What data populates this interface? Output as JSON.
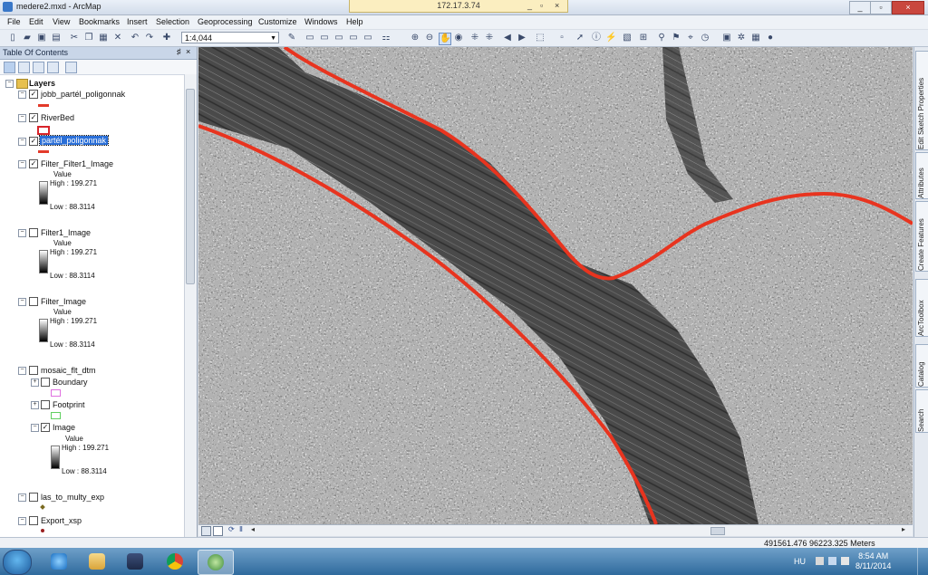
{
  "window": {
    "title": "medere2.mxd - ArcMap",
    "remote_session": "172.17.3.74",
    "controls": [
      "_",
      "▫",
      "×"
    ]
  },
  "menu": [
    "File",
    "Edit",
    "View",
    "Bookmarks",
    "Insert",
    "Selection",
    "Geoprocessing",
    "Customize",
    "Windows",
    "Help"
  ],
  "toolbar": {
    "scale": "1:4,044"
  },
  "toc": {
    "title": "Table Of Contents",
    "root": "Layers",
    "layers": [
      {
        "name": "jobb_partél_poligonnak",
        "checked": true
      },
      {
        "name": "RiverBed",
        "checked": true
      },
      {
        "name": "partél_poligonnak",
        "checked": true,
        "selected": true
      },
      {
        "name": "Filter_Filter1_Image",
        "checked": true,
        "value_label": "Value",
        "high": "High : 199.271",
        "low": "Low : 88.3114"
      },
      {
        "name": "Filter1_Image",
        "checked": false,
        "value_label": "Value",
        "high": "High : 199.271",
        "low": "Low : 88.3114"
      },
      {
        "name": "Filter_Image",
        "checked": false,
        "value_label": "Value",
        "high": "High : 199.271",
        "low": "Low : 88.3114"
      },
      {
        "name": "mosaic_flt_dtm",
        "checked": false,
        "sublayers": [
          {
            "name": "Boundary",
            "checked": false
          },
          {
            "name": "Footprint",
            "checked": false
          },
          {
            "name": "Image",
            "checked": true,
            "value_label": "Value",
            "high": "High : 199.271",
            "low": "Low : 88.3114"
          }
        ]
      },
      {
        "name": "las_to_multy_exp",
        "checked": false
      },
      {
        "name": "Export_xsp",
        "checked": false
      }
    ]
  },
  "dock_tabs": [
    "Edit Sketch Properties",
    "Attributes",
    "Create Features",
    "ArcToolbox",
    "Catalog",
    "Search"
  ],
  "status": {
    "coordinates": "491561.476  96223.325 Meters"
  },
  "taskbar": {
    "language": "HU",
    "time": "8:54 AM",
    "date": "8/11/2014"
  },
  "colors": {
    "river_line": "#e8341f",
    "selection": "#2a6fd8",
    "taskbar": "#2f6a9d"
  }
}
